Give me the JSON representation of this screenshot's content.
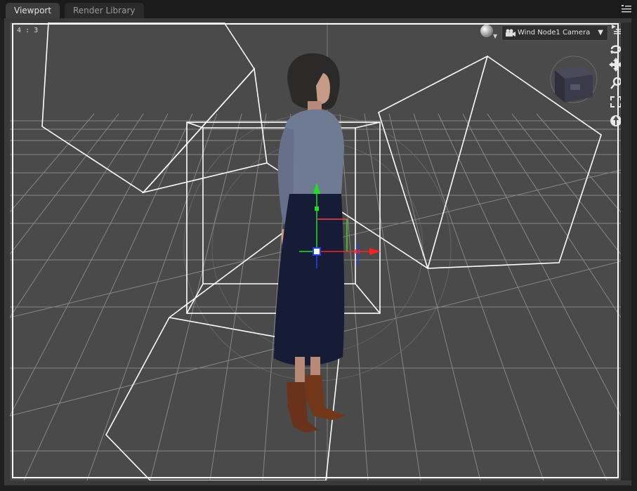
{
  "tabs": [
    {
      "label": "Viewport",
      "active": true
    },
    {
      "label": "Render Library",
      "active": false
    }
  ],
  "viewport": {
    "aspect_label": "4 : 3",
    "camera": "Wind Node1 Camera",
    "icons": [
      "draw-style-icon",
      "camera-icon",
      "dropdown-caret-icon",
      "panel-menu-icon",
      "orbit-icon",
      "pan-icon",
      "zoom-icon",
      "frame-icon",
      "reset-icon",
      "nav-cube-icon"
    ]
  },
  "colors": {
    "background": "#4a4a4a",
    "grid": "#bcbcbc",
    "wireframe": "#ffffff",
    "gizmo_x": "#ff2020",
    "gizmo_y": "#20e020",
    "gizmo_z": "#2040ff"
  }
}
